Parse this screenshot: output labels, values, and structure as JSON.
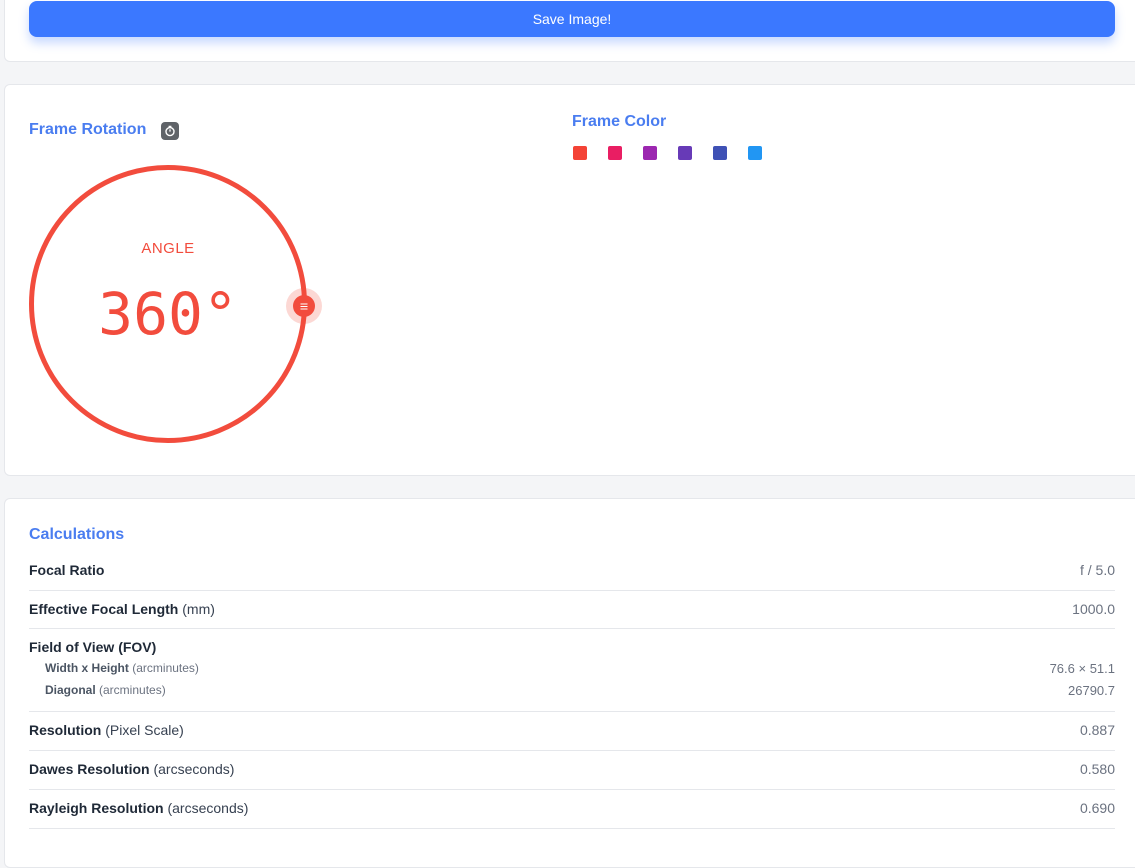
{
  "toolbar": {
    "save_label": "Save Image!"
  },
  "rotation": {
    "title": "Frame Rotation",
    "reset_icon": "reset-timer-icon",
    "angle_label": "ANGLE",
    "angle_value": "360°",
    "angle_degrees": 360,
    "accent": "#f24c3d"
  },
  "frame_color": {
    "title": "Frame Color",
    "swatches": [
      "#f44336",
      "#e91e63",
      "#9c27b0",
      "#673ab7",
      "#3f51b5",
      "#2196f3"
    ]
  },
  "calculations": {
    "title": "Calculations",
    "focal_ratio": {
      "label": "Focal Ratio",
      "unit": "",
      "value": "f / 5.0"
    },
    "effective_focal_length": {
      "label": "Effective Focal Length",
      "unit": "(mm)",
      "value": "1000.0"
    },
    "fov": {
      "label": "Field of View (FOV)",
      "width_height": {
        "label": "Width x Height",
        "unit": "(arcminutes)",
        "value": "76.6 × 51.1"
      },
      "diagonal": {
        "label": "Diagonal",
        "unit": "(arcminutes)",
        "value": "26790.7"
      }
    },
    "resolution": {
      "label": "Resolution",
      "unit": "(Pixel Scale)",
      "value": "0.887"
    },
    "dawes": {
      "label": "Dawes Resolution",
      "unit": "(arcseconds)",
      "value": "0.580"
    },
    "rayleigh": {
      "label": "Rayleigh Resolution",
      "unit": "(arcseconds)",
      "value": "0.690"
    }
  }
}
